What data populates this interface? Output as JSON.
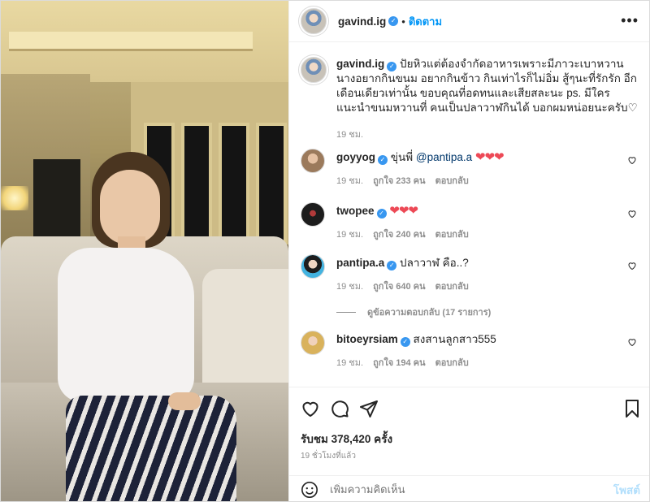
{
  "header": {
    "username": "gavind.ig",
    "follow_label": "ติดตาม",
    "more_label": "•••"
  },
  "caption": {
    "username": "gavind.ig",
    "text": "ปัยหิวแต่ต้องจำกัดอาหารเพราะมีภาวะเบาหวาน นางอยากกินขนม อยากกินข้าว กินเท่าไรก็ไม่อิ่ม สู้ๆนะที่รักรัก อีกเดือนเดียวเท่านั้น ขอบคุณที่อดทนและเสียสละนะ ps. มีใครแนะนำขนมหวานที่ คนเป็นปลาวาฬกินได้ บอกผมหน่อยนะครับ♡",
    "time": "19 ชม."
  },
  "comments": [
    {
      "username": "goyyog",
      "prefix": "ขุ่นพี่ ",
      "mention": "@pantipa.a",
      "suffix": "",
      "hearts": "❤❤❤",
      "time": "19 ชม.",
      "likes": "ถูกใจ 233 คน",
      "reply": "ตอบกลับ"
    },
    {
      "username": "twopee",
      "prefix": "",
      "mention": "",
      "suffix": "",
      "hearts": "❤❤❤",
      "time": "19 ชม.",
      "likes": "ถูกใจ 240 คน",
      "reply": "ตอบกลับ"
    },
    {
      "username": "pantipa.a",
      "prefix": "ปลาวาฬ คือ..?",
      "mention": "",
      "suffix": "",
      "hearts": "",
      "time": "19 ชม.",
      "likes": "ถูกใจ 640 คน",
      "reply": "ตอบกลับ"
    },
    {
      "username": "bitoeyrsiam",
      "prefix": "สงสานลูกสาว555",
      "mention": "",
      "suffix": "",
      "hearts": "",
      "time": "19 ชม.",
      "likes": "ถูกใจ 194 คน",
      "reply": "ตอบกลับ"
    }
  ],
  "view_replies": "ดูข้อความตอบกลับ (17 รายการ)",
  "stats": {
    "views": "รับชม 378,420 ครั้ง",
    "ago": "19 ชั่วโมงที่แล้ว"
  },
  "add_comment": {
    "placeholder": "เพิ่มความคิดเห็น",
    "post_label": "โพสต์"
  },
  "colors": {
    "accent": "#0095f6",
    "verified": "#3897f0",
    "heart": "#ed4956",
    "muted": "#8e8e8e"
  }
}
